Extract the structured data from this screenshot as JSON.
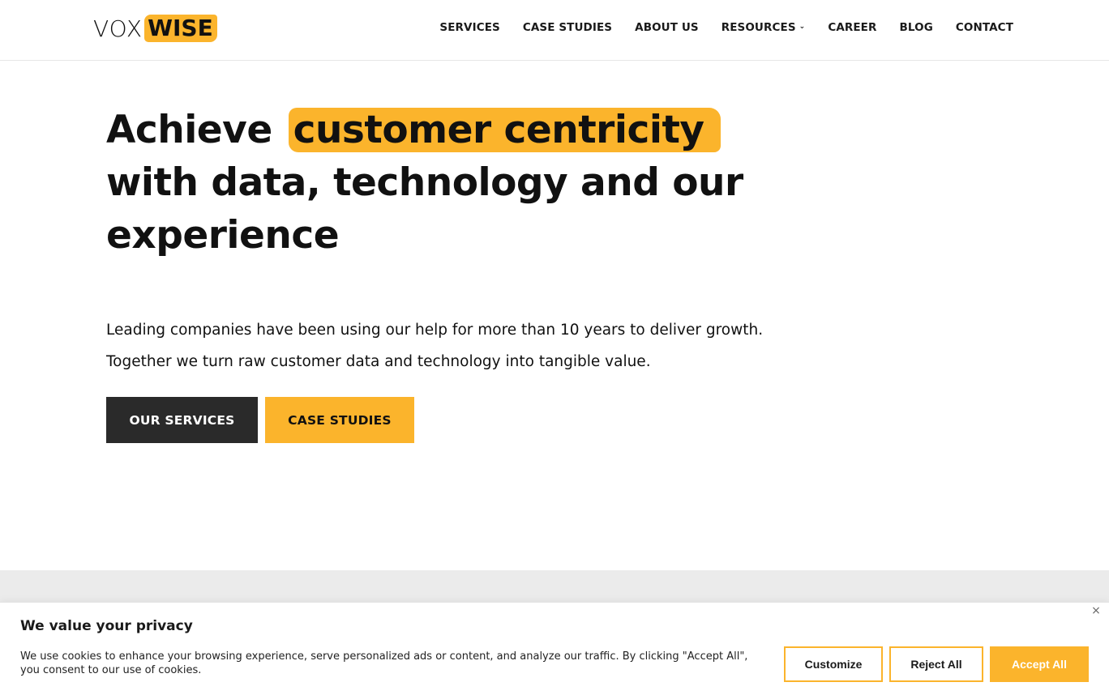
{
  "header": {
    "logo": {
      "part1": "VOX",
      "part2": "WISE"
    },
    "nav": [
      {
        "label": "SERVICES"
      },
      {
        "label": "CASE STUDIES"
      },
      {
        "label": "ABOUT US"
      },
      {
        "label": "RESOURCES",
        "has_dropdown": true
      },
      {
        "label": "CAREER"
      },
      {
        "label": "BLOG"
      },
      {
        "label": "CONTACT"
      }
    ]
  },
  "hero": {
    "title_before": "Achieve",
    "title_highlight": "customer centricity",
    "title_after": "with data, technology and our experience",
    "sub_line1": "Leading companies have been using our help for more than 10 years to deliver growth.",
    "sub_line2": "Together we turn raw customer data and technology into tangible value.",
    "btn_primary": "OUR SERVICES",
    "btn_secondary": "CASE STUDIES"
  },
  "cookie": {
    "title": "We value your privacy",
    "text": "We use cookies to enhance your browsing experience, serve personalized ads or content, and analyze our traffic. By clicking \"Accept All\", you consent to our use of cookies.",
    "close_icon": "×",
    "customize": "Customize",
    "reject": "Reject All",
    "accept": "Accept All"
  },
  "colors": {
    "accent": "#fbb42c",
    "dark_button": "#2a2a2a",
    "band": "#ebebeb"
  }
}
